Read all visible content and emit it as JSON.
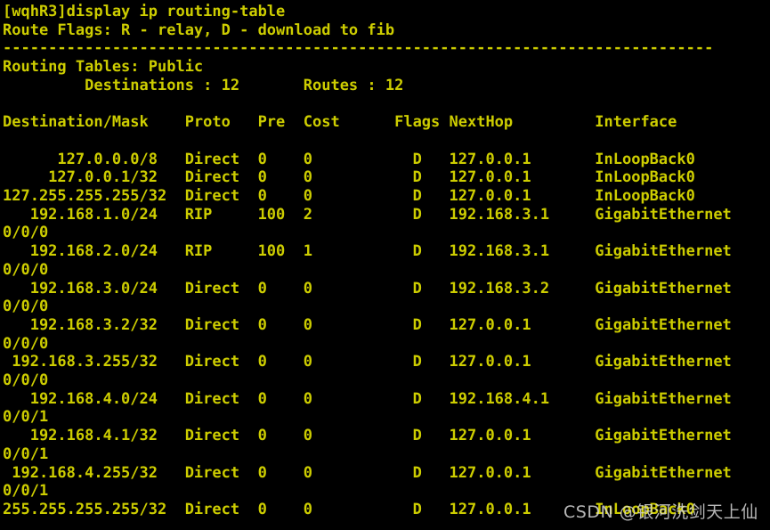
{
  "terminal": {
    "prompt": "[wqhR3]",
    "command": "display ip routing-table",
    "prompt_line": "[wqhR3]display ip routing-table",
    "route_flags_line": "Route Flags: R - relay, D - download to fib",
    "separator_line": "------------------------------------------------------------------------------",
    "routing_tables_line": "Routing Tables: Public",
    "summary_line": "         Destinations : 12       Routes : 12",
    "destinations_label": "Destinations :",
    "destinations_count": "12",
    "routes_label": "Routes :",
    "routes_count": "12",
    "table_name": "Routing Tables: Public",
    "columns": [
      "Destination/Mask",
      "Proto",
      "Pre",
      "Cost",
      "Flags",
      "NextHop",
      "Interface"
    ],
    "header_line": "Destination/Mask    Proto   Pre  Cost      Flags NextHop         Interface",
    "rows": [
      {
        "destination_mask": "127.0.0.0/8",
        "proto": "Direct",
        "pre": "0",
        "cost": "0",
        "flags": "D",
        "nexthop": "127.0.0.1",
        "interface": "InLoopBack0",
        "interface_wrap": ""
      },
      {
        "destination_mask": "127.0.0.1/32",
        "proto": "Direct",
        "pre": "0",
        "cost": "0",
        "flags": "D",
        "nexthop": "127.0.0.1",
        "interface": "InLoopBack0",
        "interface_wrap": ""
      },
      {
        "destination_mask": "127.255.255.255/32",
        "proto": "Direct",
        "pre": "0",
        "cost": "0",
        "flags": "D",
        "nexthop": "127.0.0.1",
        "interface": "InLoopBack0",
        "interface_wrap": ""
      },
      {
        "destination_mask": "192.168.1.0/24",
        "proto": "RIP",
        "pre": "100",
        "cost": "2",
        "flags": "D",
        "nexthop": "192.168.3.1",
        "interface": "GigabitEthernet",
        "interface_wrap": "0/0/0"
      },
      {
        "destination_mask": "192.168.2.0/24",
        "proto": "RIP",
        "pre": "100",
        "cost": "1",
        "flags": "D",
        "nexthop": "192.168.3.1",
        "interface": "GigabitEthernet",
        "interface_wrap": "0/0/0"
      },
      {
        "destination_mask": "192.168.3.0/24",
        "proto": "Direct",
        "pre": "0",
        "cost": "0",
        "flags": "D",
        "nexthop": "192.168.3.2",
        "interface": "GigabitEthernet",
        "interface_wrap": "0/0/0"
      },
      {
        "destination_mask": "192.168.3.2/32",
        "proto": "Direct",
        "pre": "0",
        "cost": "0",
        "flags": "D",
        "nexthop": "127.0.0.1",
        "interface": "GigabitEthernet",
        "interface_wrap": "0/0/0"
      },
      {
        "destination_mask": "192.168.3.255/32",
        "proto": "Direct",
        "pre": "0",
        "cost": "0",
        "flags": "D",
        "nexthop": "127.0.0.1",
        "interface": "GigabitEthernet",
        "interface_wrap": "0/0/0"
      },
      {
        "destination_mask": "192.168.4.0/24",
        "proto": "Direct",
        "pre": "0",
        "cost": "0",
        "flags": "D",
        "nexthop": "192.168.4.1",
        "interface": "GigabitEthernet",
        "interface_wrap": "0/0/1"
      },
      {
        "destination_mask": "192.168.4.1/32",
        "proto": "Direct",
        "pre": "0",
        "cost": "0",
        "flags": "D",
        "nexthop": "127.0.0.1",
        "interface": "GigabitEthernet",
        "interface_wrap": "0/0/1"
      },
      {
        "destination_mask": "192.168.4.255/32",
        "proto": "Direct",
        "pre": "0",
        "cost": "0",
        "flags": "D",
        "nexthop": "127.0.0.1",
        "interface": "GigabitEthernet",
        "interface_wrap": "0/0/1"
      },
      {
        "destination_mask": "255.255.255.255/32",
        "proto": "Direct",
        "pre": "0",
        "cost": "0",
        "flags": "D",
        "nexthop": "127.0.0.1",
        "interface": "InLoopBack0",
        "interface_wrap": ""
      }
    ],
    "full_text": "[wqhR3]display ip routing-table\nRoute Flags: R - relay, D - download to fib\n------------------------------------------------------------------------------\nRouting Tables: Public\n         Destinations : 12       Routes : 12\n\nDestination/Mask    Proto   Pre  Cost      Flags NextHop         Interface\n\n      127.0.0.0/8   Direct  0    0           D   127.0.0.1       InLoopBack0\n     127.0.0.1/32   Direct  0    0           D   127.0.0.1       InLoopBack0\n127.255.255.255/32  Direct  0    0           D   127.0.0.1       InLoopBack0\n   192.168.1.0/24   RIP     100  2           D   192.168.3.1     GigabitEthernet\n0/0/0\n   192.168.2.0/24   RIP     100  1           D   192.168.3.1     GigabitEthernet\n0/0/0\n   192.168.3.0/24   Direct  0    0           D   192.168.3.2     GigabitEthernet\n0/0/0\n   192.168.3.2/32   Direct  0    0           D   127.0.0.1       GigabitEthernet\n0/0/0\n 192.168.3.255/32   Direct  0    0           D   127.0.0.1       GigabitEthernet\n0/0/0\n   192.168.4.0/24   Direct  0    0           D   192.168.4.1     GigabitEthernet\n0/0/1\n   192.168.4.1/32   Direct  0    0           D   127.0.0.1       GigabitEthernet\n0/0/1\n 192.168.4.255/32   Direct  0    0           D   127.0.0.1       GigabitEthernet\n0/0/1\n255.255.255.255/32  Direct  0    0           D   127.0.0.1       InLoopBack0"
  },
  "watermark": {
    "text": "CSDN @银河洗剑天上仙"
  },
  "colors": {
    "background": "#000000",
    "text": "#cdcd00",
    "watermark": "#d8d8d8"
  }
}
